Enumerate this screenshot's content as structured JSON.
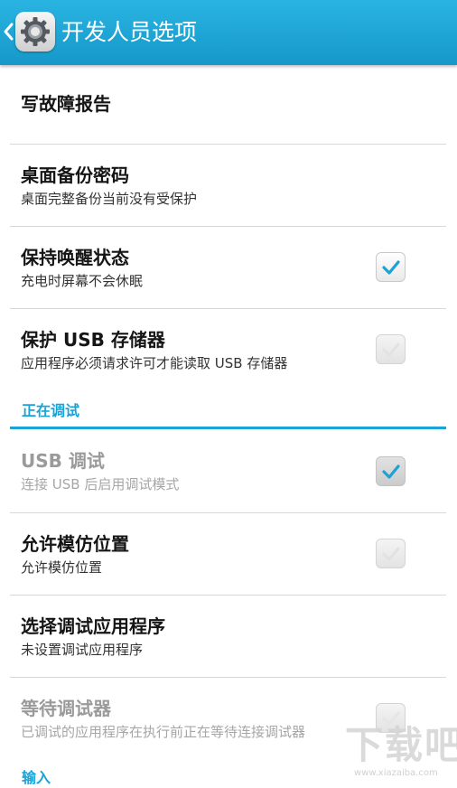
{
  "header": {
    "title": "开发人员选项",
    "back_icon": "chevron-left-icon",
    "app_icon": "settings-gear-icon",
    "color": "#1aa3d6"
  },
  "rows": [
    {
      "title": "写故障报告"
    },
    {
      "title": "桌面备份密码",
      "subtitle": "桌面完整备份当前没有受保护"
    },
    {
      "title": "保持唤醒状态",
      "subtitle": "充电时屏幕不会休眠",
      "checked": true
    },
    {
      "title": "保护 USB 存储器",
      "subtitle": "应用程序必须请求许可才能读取 USB 存储器",
      "checked": false
    }
  ],
  "section_debugging": {
    "header": "正在调试",
    "rows": [
      {
        "title": "USB 调试",
        "subtitle": "连接 USB 后启用调试模式",
        "checked": true,
        "enabled": false
      },
      {
        "title": "允许模仿位置",
        "subtitle": "允许模仿位置",
        "checked": false
      },
      {
        "title": "选择调试应用程序",
        "subtitle": "未设置调试应用程序"
      },
      {
        "title": "等待调试器",
        "subtitle": "已调试的应用程序在执行前正在等待连接调试器",
        "checked": false,
        "enabled": false
      }
    ]
  },
  "section_input": {
    "header": "输入"
  },
  "watermark": {
    "text": "下载吧",
    "url": "www.xiazaiba.com"
  }
}
